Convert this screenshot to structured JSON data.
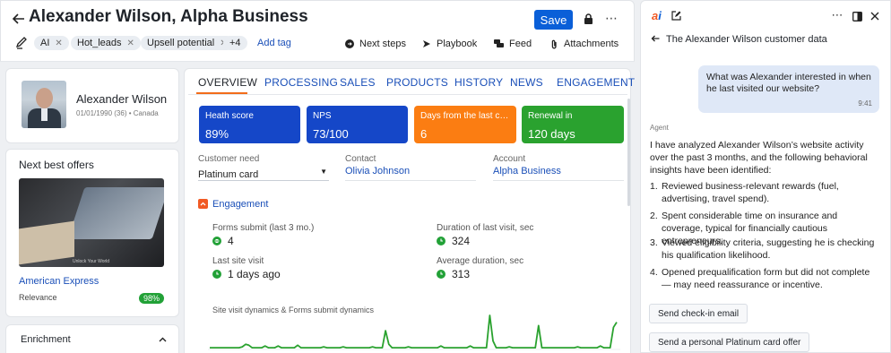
{
  "header": {
    "title": "Alexander Wilson, Alpha Business",
    "save_label": "Save",
    "tags": [
      "AI",
      "Hot_leads",
      "Upsell potential"
    ],
    "more_tags": "+4",
    "add_tag": "Add tag",
    "actions": [
      "Next steps",
      "Playbook",
      "Feed",
      "Attachments"
    ]
  },
  "profile": {
    "name": "Alexander Wilson",
    "meta": "01/01/1990 (36) • Canada"
  },
  "offers": {
    "title": "Next best offers",
    "image_caption": "Unlock Your World",
    "offer_name": "American Express",
    "relevance_label": "Relevance",
    "relevance_value": "98%"
  },
  "enrichment": {
    "title": "Enrichment"
  },
  "tabs": [
    "OVERVIEW",
    "PROCESSING",
    "SALES",
    "PRODUCTS",
    "HISTORY",
    "NEWS",
    "ENGAGEMENT"
  ],
  "kpis": [
    {
      "label": "Heath score",
      "value": "89%",
      "color": "#1547c8"
    },
    {
      "label": "NPS",
      "value": "73/100",
      "color": "#1547c8"
    },
    {
      "label": "Days from the last co...",
      "value": "6",
      "color": "#fb7d12"
    },
    {
      "label": "Renewal in",
      "value": "120 days",
      "color": "#2aa22f"
    }
  ],
  "fields": {
    "need_label": "Customer need",
    "need_value": "Platinum card",
    "contact_label": "Contact",
    "contact_value": "Olivia Johnson",
    "account_label": "Account",
    "account_value": "Alpha Business"
  },
  "engagement": {
    "title": "Engagement",
    "forms_label": "Forms submit (last 3 mo.)",
    "forms_value": "4",
    "duration_label": "Duration of last visit, sec",
    "duration_value": "324",
    "lastvisit_label": "Last site visit",
    "lastvisit_value": "1 days ago",
    "avg_label": "Average duration, sec",
    "avg_value": "313",
    "chart_title": "Site visit dynamics & Forms submit dynamics"
  },
  "chart_data": {
    "type": "line",
    "series_color": "#2aa22f",
    "values": [
      2,
      2,
      2,
      2,
      2,
      2,
      2,
      2,
      2,
      2,
      3,
      6,
      5,
      2,
      2,
      2,
      2,
      4,
      2,
      2,
      2,
      4,
      2,
      2,
      2,
      2,
      2,
      5,
      2,
      2,
      2,
      2,
      2,
      2,
      2,
      3,
      2,
      2,
      2,
      2,
      2,
      3,
      2,
      2,
      2,
      2,
      2,
      2,
      2,
      2,
      3,
      2,
      2,
      2,
      22,
      6,
      2,
      2,
      2,
      2,
      2,
      3,
      2,
      2,
      2,
      2,
      2,
      2,
      2,
      2,
      2,
      4,
      2,
      2,
      2,
      2,
      2,
      2,
      2,
      2,
      4,
      2,
      2,
      2,
      2,
      2,
      40,
      10,
      2,
      2,
      2,
      2,
      3,
      2,
      2,
      2,
      2,
      2,
      2,
      2,
      2,
      28,
      2,
      2,
      2,
      2,
      2,
      2,
      2,
      2,
      2,
      2,
      2,
      3,
      2,
      2,
      2,
      2,
      2,
      2,
      4,
      2,
      2,
      2,
      26,
      32
    ]
  },
  "assistant": {
    "title": "The Alexander Wilson customer data",
    "user_message": "What was Alexander interested in when he last visited our website?",
    "user_time": "9:41",
    "agent_label": "Agent",
    "intro": "I have analyzed Alexander Wilson’s website activity over the past 3 months, and the following behavioral insights have been identified:",
    "points": [
      "Reviewed business-relevant rewards (fuel, advertising, travel spend).",
      "Spent considerable time on insurance and coverage, typical for financially cautious entrepreneurs.",
      "Viewed eligibility criteria, suggesting he is checking his qualification likelihood.",
      "Opened prequalification form but did not complete — may need reassurance or incentive."
    ],
    "suggestions": [
      "Send check-in email",
      "Send a personal Platinum card offer"
    ]
  }
}
